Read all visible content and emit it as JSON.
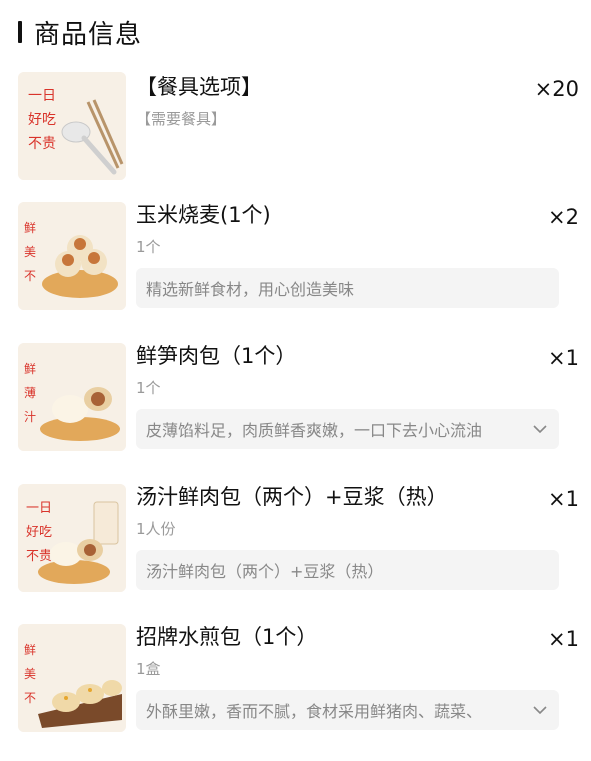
{
  "section": {
    "title": "商品信息"
  },
  "items": [
    {
      "name": "【餐具选项】",
      "qty": "×20",
      "spec": "【需要餐具】",
      "desc": "",
      "thumb": "cutlery-icon"
    },
    {
      "name": "玉米烧麦(1个)",
      "qty": "×2",
      "spec": "1个",
      "desc": "精选新鲜食材，用心创造美味",
      "thumb": "shaomai-icon"
    },
    {
      "name": "鲜笋肉包（1个）",
      "qty": "×1",
      "spec": "1个",
      "desc": "皮薄馅料足，肉质鲜香爽嫩，一口下去小心流油",
      "thumb": "bun-icon"
    },
    {
      "name": "汤汁鲜肉包（两个）+豆浆（热）",
      "qty": "×1",
      "spec": "1人份",
      "desc": "汤汁鲜肉包（两个）+豆浆（热）",
      "thumb": "bun-and-soymilk-icon"
    },
    {
      "name": "招牌水煎包（1个）",
      "qty": "×1",
      "spec": "1盒",
      "desc": "外酥里嫩，香而不腻，食材采用鲜猪肉、蔬菜、",
      "thumb": "fried-bun-icon"
    }
  ],
  "colors": {
    "title": "#111111",
    "muted": "#9a9a9a",
    "desc_bg": "#f4f4f4",
    "brand_red": "#d9342b"
  }
}
